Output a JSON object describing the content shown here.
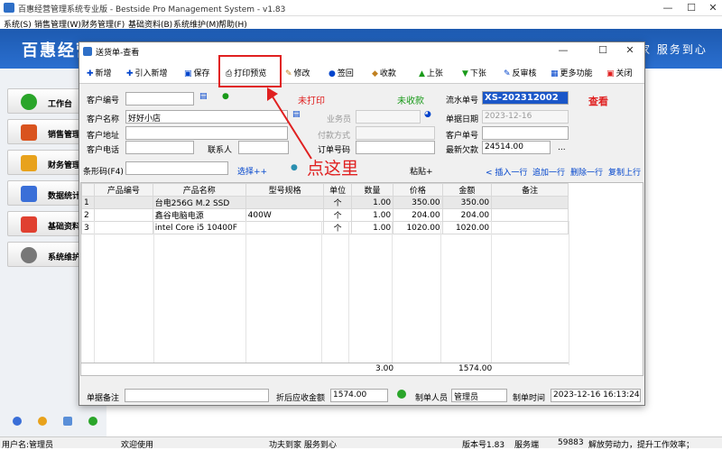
{
  "app": {
    "title": "百惠经营管理系统专业版 - Bestside Pro Management System - v1.83",
    "window_controls": [
      "—",
      "☐",
      "✕"
    ],
    "menu": [
      "系统(S)",
      "销售管理(W)",
      "财务管理(F)",
      "基础资料(B)",
      "系统维护(M)",
      "帮助(H)"
    ],
    "brand": "百惠经营",
    "slogan": "家  服务到心",
    "nav": [
      {
        "label": "工作台",
        "color": "#2aa52a"
      },
      {
        "label": "销售管理",
        "color": "#d9531e"
      },
      {
        "label": "财务管理",
        "color": "#e8a21c"
      },
      {
        "label": "数据统计",
        "color": "#3a6fd8"
      },
      {
        "label": "基础资料",
        "color": "#e04030"
      },
      {
        "label": "系统维护",
        "color": "#777777"
      }
    ],
    "status": {
      "user": "用户名:管理员",
      "welcome": "欢迎使用",
      "motto": "功夫到家 服务到心",
      "version": "版本号1.83",
      "server": "服务端",
      "port": "59883",
      "tagline": "解放劳动力，提升工作效率；"
    }
  },
  "dialog": {
    "title": "送货单-查看",
    "controls": [
      "—",
      "☐",
      "✕"
    ],
    "toolbar": [
      {
        "icon": "plus",
        "label": "新增"
      },
      {
        "icon": "plus",
        "label": "引入新增"
      },
      {
        "icon": "save",
        "label": "保存"
      },
      {
        "icon": "print",
        "label": "打印预览"
      },
      {
        "icon": "edit",
        "label": "修改"
      },
      {
        "icon": "sign",
        "label": "签回"
      },
      {
        "icon": "money",
        "label": "收款"
      },
      {
        "icon": "up",
        "label": "上张"
      },
      {
        "icon": "down",
        "label": "下张"
      },
      {
        "icon": "uncheck",
        "label": "反审核"
      },
      {
        "icon": "more",
        "label": "更多功能"
      },
      {
        "icon": "close",
        "label": "关闭"
      }
    ],
    "form": {
      "customer_no_label": "客户编号",
      "customer_no": "",
      "customer_name_label": "客户名称",
      "customer_name": "好好小店",
      "customer_addr_label": "客户地址",
      "customer_addr": "",
      "customer_phone_label": "客户电话",
      "customer_phone": "",
      "contact_label": "联系人",
      "contact": "",
      "print_status": "未打印",
      "pay_status": "未收款",
      "salesman_label": "业务员",
      "salesman": "",
      "payment_label": "付款方式",
      "payment": "",
      "order_no_label": "订单号码",
      "order_no": "",
      "serial_label": "流水单号",
      "serial": "XS-202312002",
      "mode": "查看",
      "date_label": "单据日期",
      "date": "2023-12-16",
      "cust_doc_label": "客户单号",
      "cust_doc": "",
      "latest_debt_label": "最新欠款",
      "latest_debt": "24514.00",
      "ellipsis": "..."
    },
    "barcode": {
      "label": "条形码(F4)",
      "value": "",
      "select": "选择++",
      "paste": "粘贴+",
      "actions": [
        "< 插入一行",
        "追加一行",
        "删除一行",
        "复制上行"
      ]
    },
    "grid": {
      "columns": [
        "",
        "产品编号",
        "产品名称",
        "型号规格",
        "单位",
        "数量",
        "价格",
        "金额",
        "备注"
      ],
      "rows": [
        [
          "1",
          "",
          "台电256G M.2 SSD",
          "",
          "个",
          "1.00",
          "350.00",
          "350.00",
          ""
        ],
        [
          "2",
          "",
          "鑫谷电脑电源",
          "400W",
          "个",
          "1.00",
          "204.00",
          "204.00",
          ""
        ],
        [
          "3",
          "",
          "intel Core i5 10400F",
          "",
          "个",
          "1.00",
          "1020.00",
          "1020.00",
          ""
        ]
      ],
      "total_qty": "3.00",
      "total_amount": "1574.00"
    },
    "footer": {
      "remark_label": "单据备注",
      "remark": "",
      "discount_label": "折后应收金额",
      "discount": "1574.00",
      "maker_label": "制单人员",
      "maker": "管理员",
      "time_label": "制单时间",
      "time": "2023-12-16 16:13:24"
    }
  },
  "annotation": {
    "text": "点这里"
  }
}
